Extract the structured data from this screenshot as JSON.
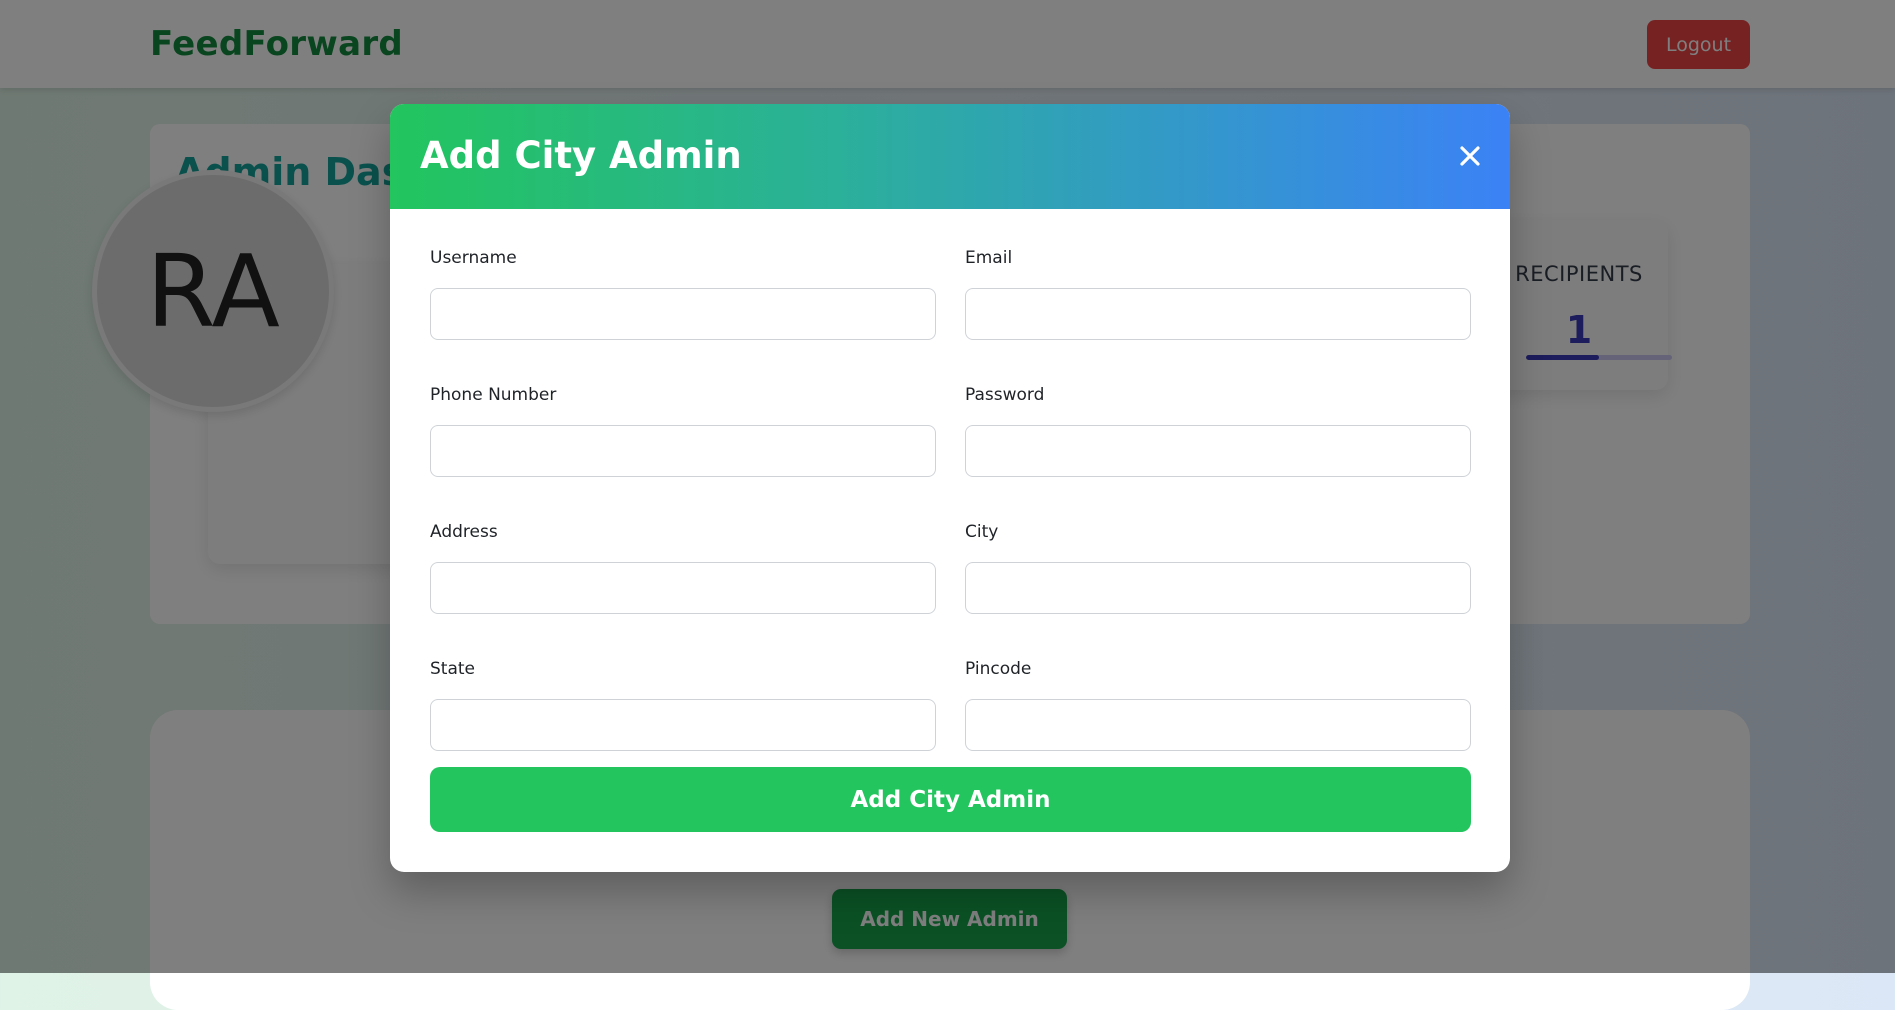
{
  "navbar": {
    "brand": "FeedForward",
    "logout_label": "Logout"
  },
  "dashboard": {
    "title": "Admin Dash",
    "avatar_initials": "RA",
    "stat": {
      "label": "RECIPIENTS",
      "value": "1",
      "progress_fraction": 0.5
    },
    "add_new_admin_label": "Add New Admin"
  },
  "modal": {
    "title": "Add City Admin",
    "close_icon": "close-icon",
    "fields": {
      "username": {
        "label": "Username",
        "value": ""
      },
      "email": {
        "label": "Email",
        "value": ""
      },
      "phone": {
        "label": "Phone Number",
        "value": ""
      },
      "password": {
        "label": "Password",
        "value": ""
      },
      "address": {
        "label": "Address",
        "value": ""
      },
      "city": {
        "label": "City",
        "value": ""
      },
      "state": {
        "label": "State",
        "value": ""
      },
      "pincode": {
        "label": "Pincode",
        "value": ""
      }
    },
    "submit_label": "Add City Admin"
  },
  "colors": {
    "brand": "#138a3e",
    "logout": "#ef4444",
    "accent_green": "#22c55e",
    "accent_blue": "#3b82f6",
    "stat_value": "#3b38b8"
  }
}
